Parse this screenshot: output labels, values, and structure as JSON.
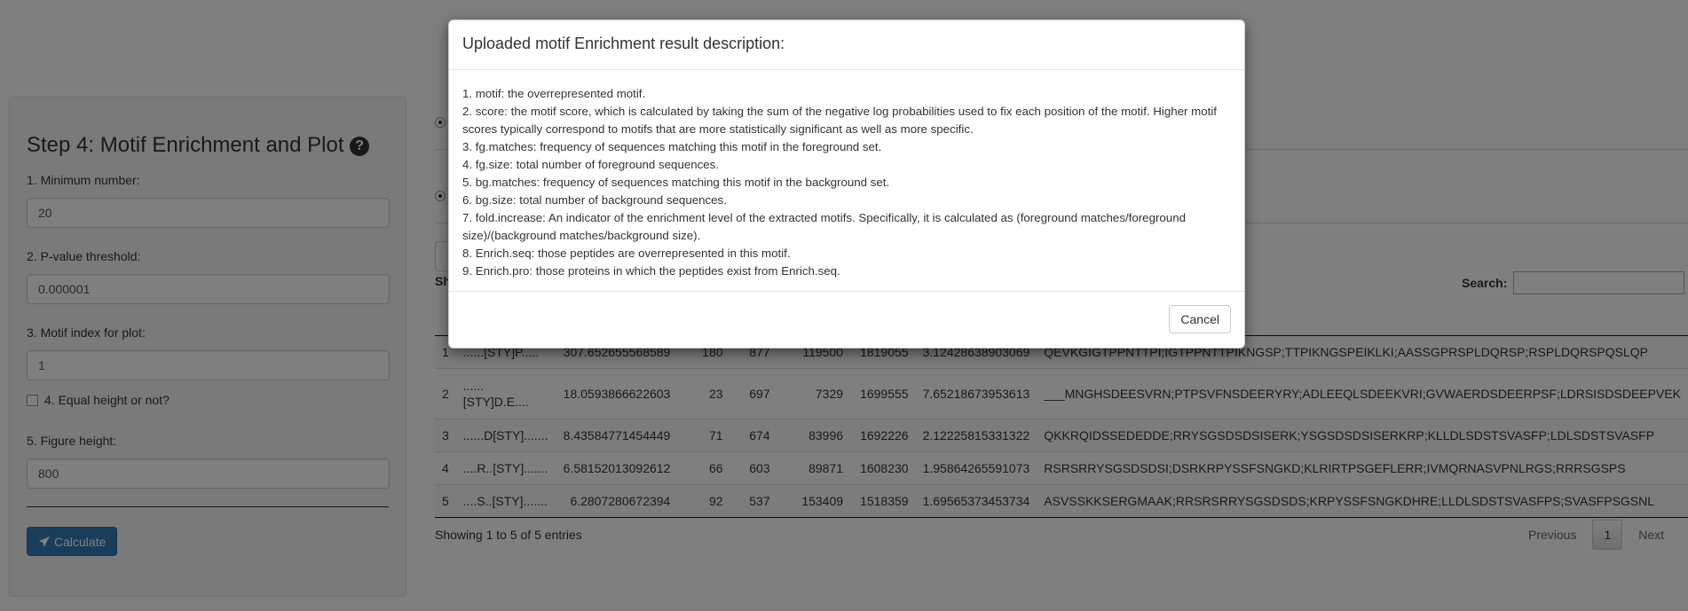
{
  "panel": {
    "title": "Step 4: Motif Enrichment and Plot",
    "help_icon": "?",
    "fields": [
      {
        "label": "1. Minimum number:",
        "value": "20"
      },
      {
        "label": "2. P-value threshold:",
        "value": "0.000001"
      },
      {
        "label": "3. Motif index for plot:",
        "value": "1"
      }
    ],
    "checkbox_label": "4. Equal height or not?",
    "height_label": "5. Figure height:",
    "height_value": "800",
    "calculate_label": "Calculate",
    "calculate_icon": "paper-plane-icon"
  },
  "table": {
    "show_fragment": "Sh",
    "search_label": "Search:",
    "rows": [
      {
        "idx": "1",
        "motif": "......[STY]P.....",
        "score": "307.652655568589",
        "fg_matches": "180",
        "fg_size": "877",
        "bg_matches": "119500",
        "bg_size": "1819055",
        "fold": "3.12428638903069",
        "seq": "QEVKGIGTPPNTTPI;IGTPPNTTPIKNGSP;TTPIKNGSPEIKLKI;AASSGPRSPLDQRSP;RSPLDQRSPQSLQP"
      },
      {
        "idx": "2",
        "motif": "...... [STY]D.E....",
        "score": "18.0593866622603",
        "fg_matches": "23",
        "fg_size": "697",
        "bg_matches": "7329",
        "bg_size": "1699555",
        "fold": "7.65218673953613",
        "seq": "___MNGHSDEESVRN;PTPSVFNSDEERYRY;ADLEEQLSDEEKVRI;GVWAERDSDEERPSF;LDRSISDSDEEPVEK"
      },
      {
        "idx": "3",
        "motif": "......D[STY].......",
        "score": "8.43584771454449",
        "fg_matches": "71",
        "fg_size": "674",
        "bg_matches": "83996",
        "bg_size": "1692226",
        "fold": "2.12225815331322",
        "seq": "QKKRQIDSSEDEDDE;RRYSGSDSDSISERK;YSGSDSDSISERKRP;KLLDLSDSTSVASFP;LDLSDSTSVASFP"
      },
      {
        "idx": "4",
        "motif": "....R..[STY].......",
        "score": "6.58152013092612",
        "fg_matches": "66",
        "fg_size": "603",
        "bg_matches": "89871",
        "bg_size": "1608230",
        "fold": "1.95864265591073",
        "seq": "RSRSRRYSGSDSDSI;DSRKRPYSSFSNGKD;KLRIRTPSGEFLERR;IVMQRNASVPNLRGS;RRRSGSPS"
      },
      {
        "idx": "5",
        "motif": "....S..[STY].......",
        "score": "6.2807280672394",
        "fg_matches": "92",
        "fg_size": "537",
        "bg_matches": "153409",
        "bg_size": "1518359",
        "fold": "1.69565373453734",
        "seq": "ASVSSKKSERGMAAK;RRSRSRRYSGSDSDS;KRPYSSFSNGKDHRE;LLDLSDSTSVASFPS;SVASFPSGSNL"
      }
    ],
    "info": "Showing 1 to 5 of 5 entries",
    "pager": {
      "previous": "Previous",
      "current": "1",
      "next": "Next"
    }
  },
  "modal": {
    "title": "Uploaded motif Enrichment result description:",
    "lines": [
      "1. motif: the overrepresented motif.",
      "2. score: the motif score, which is calculated by taking the sum of the negative log probabilities used to fix each position of the motif. Higher motif scores typically correspond to motifs that are more statistically significant as well as more specific.",
      "3. fg.matches: frequency of sequences matching this motif in the foreground set.",
      "4. fg.size: total number of foreground sequences.",
      "5. bg.matches: frequency of sequences matching this motif in the background set.",
      "6. bg.size: total number of background sequences.",
      "7. fold.increase: An indicator of the enrichment level of the extracted motifs. Specifically, it is calculated as (foreground matches/foreground size)/(background matches/background size).",
      "8. Enrich.seq: those peptides are overrepresented in this motif.",
      "9. Enrich.pro: those proteins in which the peptides exist from Enrich.seq."
    ],
    "cancel_label": "Cancel"
  }
}
